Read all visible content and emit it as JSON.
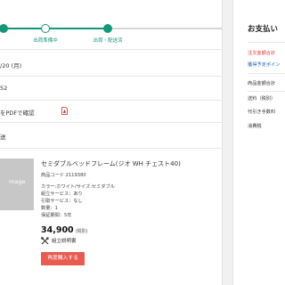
{
  "progress": {
    "steps": [
      {
        "label": ""
      },
      {
        "label": "出荷準備中"
      },
      {
        "label": "出荷・配送済"
      }
    ]
  },
  "order": {
    "date_fragment": "/20 (月)",
    "number_fragment": "52",
    "receipt_link": "をPDFで確認",
    "status_fragment": "送"
  },
  "product": {
    "image_placeholder": "mage",
    "title": "セミダブルベッドフレーム(ジオ WH チェスト40)",
    "code": "商品コード 2119380",
    "color_size": "カラー:ホワイト/サイズ:セミダブル",
    "assembly": "組立サービス：あり",
    "pickup": "引取サービス：なし",
    "quantity": "数量：1",
    "warranty": "保証期間：5年",
    "price": "34,900",
    "tax_label": "(税別)",
    "manual_label": "組立説明書",
    "rebuy_label": "再度購入する"
  },
  "payment": {
    "title": "お支払い",
    "total_label": "注文金額合計",
    "points_label": "獲得予定ポイン",
    "subtotal_label": "商品金額合計",
    "shipping_label": "送料（税別）",
    "cod_label": "代引き手数料",
    "tax_label": "消費税"
  },
  "colors": {
    "accent": "#16967a",
    "danger": "#e95a51",
    "link": "#1a5fb4"
  }
}
